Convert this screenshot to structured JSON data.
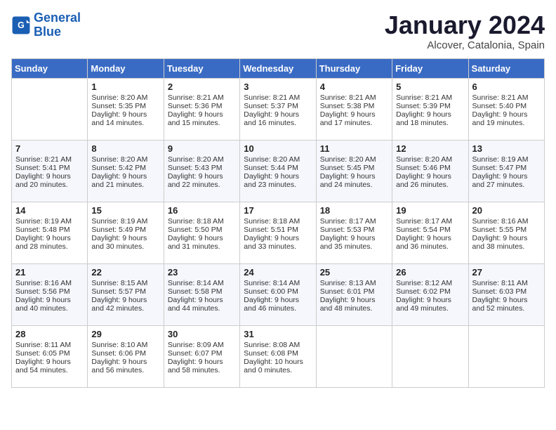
{
  "logo": {
    "line1": "General",
    "line2": "Blue"
  },
  "title": "January 2024",
  "subtitle": "Alcover, Catalonia, Spain",
  "days_header": [
    "Sunday",
    "Monday",
    "Tuesday",
    "Wednesday",
    "Thursday",
    "Friday",
    "Saturday"
  ],
  "weeks": [
    [
      {
        "num": "",
        "info": ""
      },
      {
        "num": "1",
        "info": "Sunrise: 8:20 AM\nSunset: 5:35 PM\nDaylight: 9 hours\nand 14 minutes."
      },
      {
        "num": "2",
        "info": "Sunrise: 8:21 AM\nSunset: 5:36 PM\nDaylight: 9 hours\nand 15 minutes."
      },
      {
        "num": "3",
        "info": "Sunrise: 8:21 AM\nSunset: 5:37 PM\nDaylight: 9 hours\nand 16 minutes."
      },
      {
        "num": "4",
        "info": "Sunrise: 8:21 AM\nSunset: 5:38 PM\nDaylight: 9 hours\nand 17 minutes."
      },
      {
        "num": "5",
        "info": "Sunrise: 8:21 AM\nSunset: 5:39 PM\nDaylight: 9 hours\nand 18 minutes."
      },
      {
        "num": "6",
        "info": "Sunrise: 8:21 AM\nSunset: 5:40 PM\nDaylight: 9 hours\nand 19 minutes."
      }
    ],
    [
      {
        "num": "7",
        "info": "Sunrise: 8:21 AM\nSunset: 5:41 PM\nDaylight: 9 hours\nand 20 minutes."
      },
      {
        "num": "8",
        "info": "Sunrise: 8:20 AM\nSunset: 5:42 PM\nDaylight: 9 hours\nand 21 minutes."
      },
      {
        "num": "9",
        "info": "Sunrise: 8:20 AM\nSunset: 5:43 PM\nDaylight: 9 hours\nand 22 minutes."
      },
      {
        "num": "10",
        "info": "Sunrise: 8:20 AM\nSunset: 5:44 PM\nDaylight: 9 hours\nand 23 minutes."
      },
      {
        "num": "11",
        "info": "Sunrise: 8:20 AM\nSunset: 5:45 PM\nDaylight: 9 hours\nand 24 minutes."
      },
      {
        "num": "12",
        "info": "Sunrise: 8:20 AM\nSunset: 5:46 PM\nDaylight: 9 hours\nand 26 minutes."
      },
      {
        "num": "13",
        "info": "Sunrise: 8:19 AM\nSunset: 5:47 PM\nDaylight: 9 hours\nand 27 minutes."
      }
    ],
    [
      {
        "num": "14",
        "info": "Sunrise: 8:19 AM\nSunset: 5:48 PM\nDaylight: 9 hours\nand 28 minutes."
      },
      {
        "num": "15",
        "info": "Sunrise: 8:19 AM\nSunset: 5:49 PM\nDaylight: 9 hours\nand 30 minutes."
      },
      {
        "num": "16",
        "info": "Sunrise: 8:18 AM\nSunset: 5:50 PM\nDaylight: 9 hours\nand 31 minutes."
      },
      {
        "num": "17",
        "info": "Sunrise: 8:18 AM\nSunset: 5:51 PM\nDaylight: 9 hours\nand 33 minutes."
      },
      {
        "num": "18",
        "info": "Sunrise: 8:17 AM\nSunset: 5:53 PM\nDaylight: 9 hours\nand 35 minutes."
      },
      {
        "num": "19",
        "info": "Sunrise: 8:17 AM\nSunset: 5:54 PM\nDaylight: 9 hours\nand 36 minutes."
      },
      {
        "num": "20",
        "info": "Sunrise: 8:16 AM\nSunset: 5:55 PM\nDaylight: 9 hours\nand 38 minutes."
      }
    ],
    [
      {
        "num": "21",
        "info": "Sunrise: 8:16 AM\nSunset: 5:56 PM\nDaylight: 9 hours\nand 40 minutes."
      },
      {
        "num": "22",
        "info": "Sunrise: 8:15 AM\nSunset: 5:57 PM\nDaylight: 9 hours\nand 42 minutes."
      },
      {
        "num": "23",
        "info": "Sunrise: 8:14 AM\nSunset: 5:58 PM\nDaylight: 9 hours\nand 44 minutes."
      },
      {
        "num": "24",
        "info": "Sunrise: 8:14 AM\nSunset: 6:00 PM\nDaylight: 9 hours\nand 46 minutes."
      },
      {
        "num": "25",
        "info": "Sunrise: 8:13 AM\nSunset: 6:01 PM\nDaylight: 9 hours\nand 48 minutes."
      },
      {
        "num": "26",
        "info": "Sunrise: 8:12 AM\nSunset: 6:02 PM\nDaylight: 9 hours\nand 49 minutes."
      },
      {
        "num": "27",
        "info": "Sunrise: 8:11 AM\nSunset: 6:03 PM\nDaylight: 9 hours\nand 52 minutes."
      }
    ],
    [
      {
        "num": "28",
        "info": "Sunrise: 8:11 AM\nSunset: 6:05 PM\nDaylight: 9 hours\nand 54 minutes."
      },
      {
        "num": "29",
        "info": "Sunrise: 8:10 AM\nSunset: 6:06 PM\nDaylight: 9 hours\nand 56 minutes."
      },
      {
        "num": "30",
        "info": "Sunrise: 8:09 AM\nSunset: 6:07 PM\nDaylight: 9 hours\nand 58 minutes."
      },
      {
        "num": "31",
        "info": "Sunrise: 8:08 AM\nSunset: 6:08 PM\nDaylight: 10 hours\nand 0 minutes."
      },
      {
        "num": "",
        "info": ""
      },
      {
        "num": "",
        "info": ""
      },
      {
        "num": "",
        "info": ""
      }
    ]
  ]
}
